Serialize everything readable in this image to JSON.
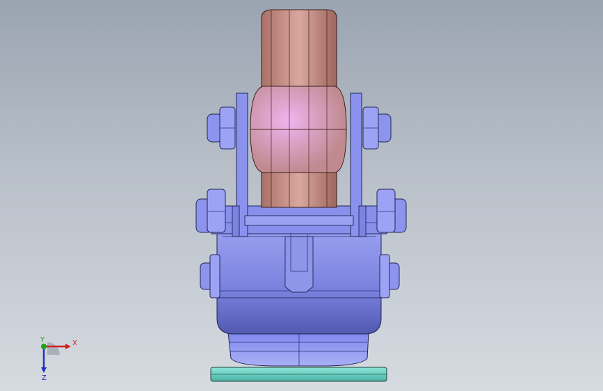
{
  "viewport": {
    "model": "caster-wheel-assembly-front-view"
  },
  "triad": {
    "x_label": "X",
    "y_label": "Y",
    "z_label": "Z"
  },
  "colors": {
    "background_top": "#9aa4b1",
    "background_bottom": "#d6dbe1",
    "wheel": "#c98f86",
    "bracket": "#7d86e0",
    "base_plate": "#6fd3c4",
    "x_axis": "#d22020",
    "y_axis": "#20a020",
    "z_axis": "#2030c0"
  }
}
